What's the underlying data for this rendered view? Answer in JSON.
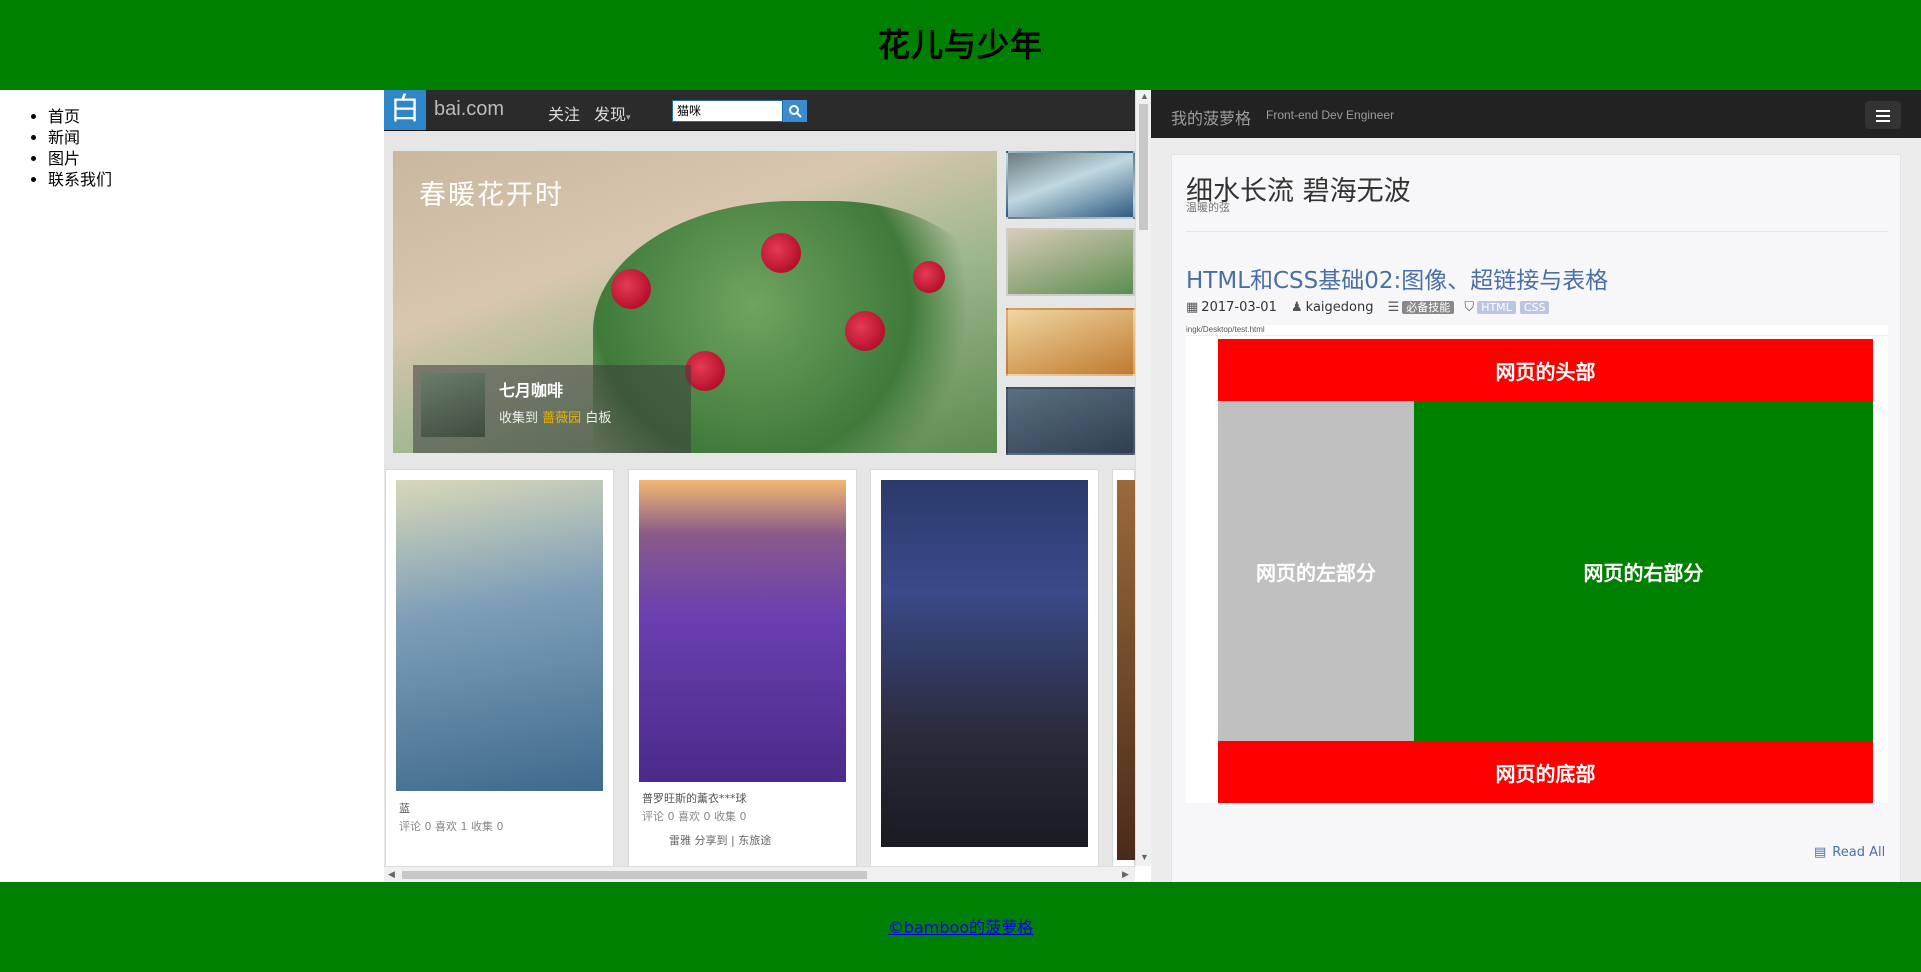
{
  "header": {
    "title": "花儿与少年"
  },
  "nav": {
    "items": [
      "首页",
      "新闻",
      "图片",
      "联系我们"
    ]
  },
  "huaban": {
    "logo_char": "白",
    "site": "bai.com",
    "follow": "关注",
    "discover": "发现",
    "search_value": "猫咪",
    "feature": {
      "title": "春暖花开时",
      "user": "七月咖啡",
      "collected_to": "收集到",
      "board": "蔷薇园",
      "board_suffix": "白板"
    },
    "pins": [
      {
        "title": "蓝",
        "stats": "评论 0 喜欢 1 收集 0"
      },
      {
        "title": "普罗旺斯的薰衣***球",
        "stats": "评论 0 喜欢 0 收集 0"
      },
      {
        "title": "",
        "stats": ""
      }
    ],
    "pin2_footer": "雷雅 分享到 | 东旅途"
  },
  "blog": {
    "brand": "我的菠萝格",
    "tagline": "Front-end Dev Engineer",
    "title": "细水长流 碧海无波",
    "subtitle": "温暖的弦",
    "post": {
      "title": "HTML和CSS基础02:图像、超链接与表格",
      "date": "2017-03-01",
      "author": "kaigedong",
      "category": "必备技能",
      "tags": [
        "HTML",
        "CSS"
      ],
      "screenshot_url": "ingk/Desktop/test.html",
      "blocks": {
        "head": "网页的头部",
        "left": "网页的左部分",
        "right": "网页的右部分",
        "foot": "网页的底部"
      },
      "read_all": "Read All"
    },
    "colors": {
      "red": "#ff0000",
      "green": "#008000",
      "gray": "#c0c0c0"
    }
  },
  "footer": {
    "link": "©bamboo的菠萝格"
  },
  "colors": {
    "page_green": "#008000",
    "huaban_blue": "#2f86c6"
  }
}
